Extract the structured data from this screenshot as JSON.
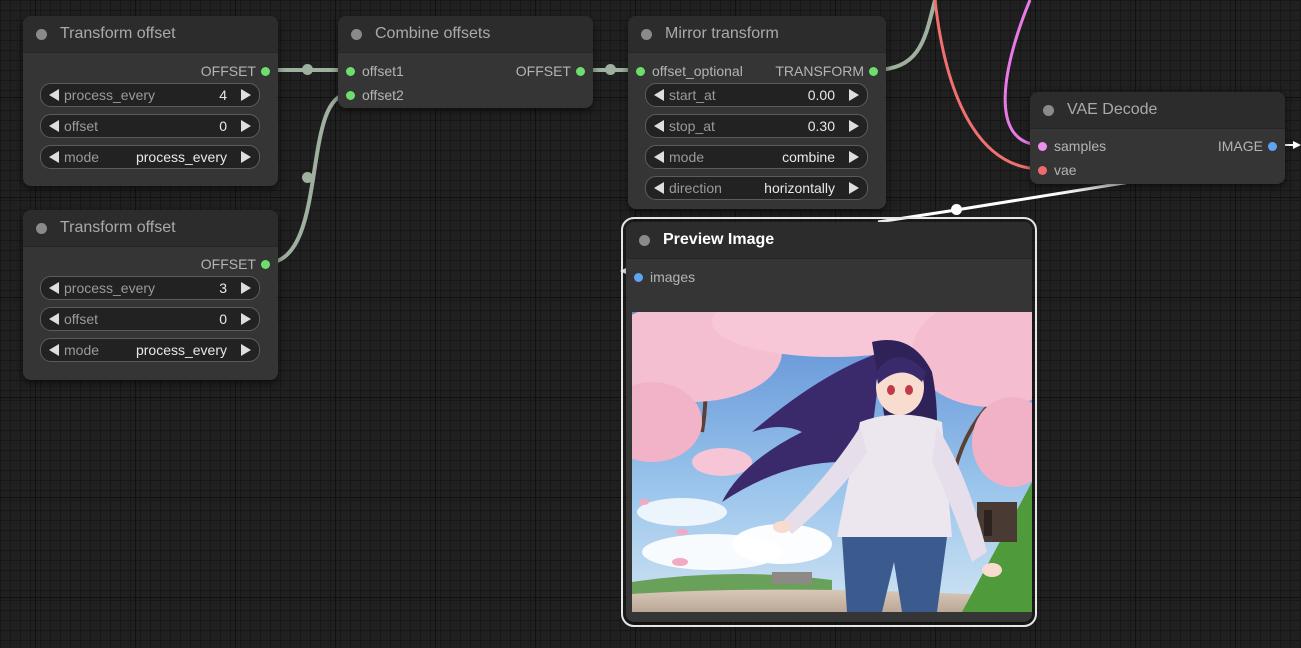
{
  "colors": {
    "canvas_bg": "#202020",
    "node_bg": "#353535",
    "node_title_bg": "#2c2c2c",
    "wire_green": "#9fb09f",
    "wire_pink": "#e87ae8",
    "wire_red": "#f07070",
    "wire_white": "#ffffff",
    "slot_green": "#6dde6d",
    "slot_pink": "#ef8ef1",
    "slot_red": "#f26a6a",
    "slot_blue": "#5fa4f0"
  },
  "nodes": {
    "transform_offset_1": {
      "title": "Transform offset",
      "output": "OFFSET",
      "widgets": [
        {
          "name": "process_every",
          "value": "4"
        },
        {
          "name": "offset",
          "value": "0"
        },
        {
          "name": "mode",
          "value": "process_every"
        }
      ]
    },
    "transform_offset_2": {
      "title": "Transform offset",
      "output": "OFFSET",
      "widgets": [
        {
          "name": "process_every",
          "value": "3"
        },
        {
          "name": "offset",
          "value": "0"
        },
        {
          "name": "mode",
          "value": "process_every"
        }
      ]
    },
    "combine_offsets": {
      "title": "Combine offsets",
      "inputs": [
        "offset1",
        "offset2"
      ],
      "output": "OFFSET"
    },
    "mirror_transform": {
      "title": "Mirror transform",
      "input": "offset_optional",
      "output": "TRANSFORM",
      "widgets": [
        {
          "name": "start_at",
          "value": "0.00"
        },
        {
          "name": "stop_at",
          "value": "0.30"
        },
        {
          "name": "mode",
          "value": "combine"
        },
        {
          "name": "direction",
          "value": "horizontally"
        }
      ]
    },
    "vae_decode": {
      "title": "VAE Decode",
      "inputs": [
        "samples",
        "vae"
      ],
      "output": "IMAGE"
    },
    "preview_image": {
      "title": "Preview Image",
      "input": "images"
    }
  }
}
